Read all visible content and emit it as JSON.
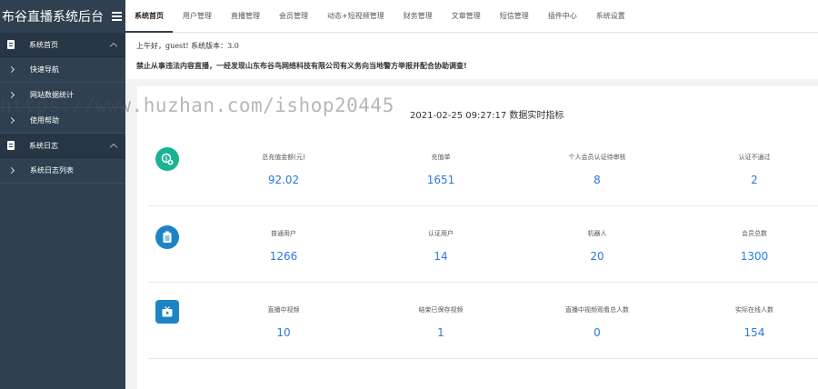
{
  "brand": {
    "title": "布谷直播系统后台"
  },
  "tabs": [
    {
      "label": "系统首页",
      "active": true
    },
    {
      "label": "用户管理"
    },
    {
      "label": "直播管理"
    },
    {
      "label": "会员管理"
    },
    {
      "label": "动态+短视频管理"
    },
    {
      "label": "财务管理"
    },
    {
      "label": "文章管理"
    },
    {
      "label": "短信管理"
    },
    {
      "label": "插件中心"
    },
    {
      "label": "系统设置"
    }
  ],
  "sidebar": {
    "groups": [
      {
        "label": "系统首页",
        "items": [
          "快速导航",
          "网站数据统计",
          "使用帮助"
        ]
      },
      {
        "label": "系统日志",
        "items": [
          "系统日志列表"
        ]
      }
    ]
  },
  "notice": {
    "greeting": "上午好，guest! 系统版本：3.0",
    "warning": "禁止从事违法内容直播，一经发现山东布谷鸟网络科技有限公司有义务向当地警方举报并配合协助调查!"
  },
  "card": {
    "title": "2021-02-25 09:27:17 数据实时指标"
  },
  "rows": [
    {
      "icon": "money-plus-icon",
      "icon_color": "#1ab394",
      "stats": [
        {
          "label": "总充值金额(元)",
          "value": "92.02"
        },
        {
          "label": "充值单",
          "value": "1651"
        },
        {
          "label": "个人会员认证待审核",
          "value": "8"
        },
        {
          "label": "认证不通过",
          "value": "2"
        }
      ]
    },
    {
      "icon": "clipboard-icon",
      "icon_color": "#1c84c6",
      "stats": [
        {
          "label": "普通用户",
          "value": "1266"
        },
        {
          "label": "认证用户",
          "value": "14"
        },
        {
          "label": "机器人",
          "value": "20"
        },
        {
          "label": "会员总数",
          "value": "1300"
        }
      ]
    },
    {
      "icon": "tv-icon",
      "icon_color": "#1c84c6",
      "stats": [
        {
          "label": "直播中视频",
          "value": "10"
        },
        {
          "label": "结束已保存视频",
          "value": "1"
        },
        {
          "label": "直播中视频观看总人数",
          "value": "0"
        },
        {
          "label": "实际在线人数",
          "value": "154"
        }
      ]
    }
  ],
  "watermark": "https://www.huzhan.com/ishop20445"
}
